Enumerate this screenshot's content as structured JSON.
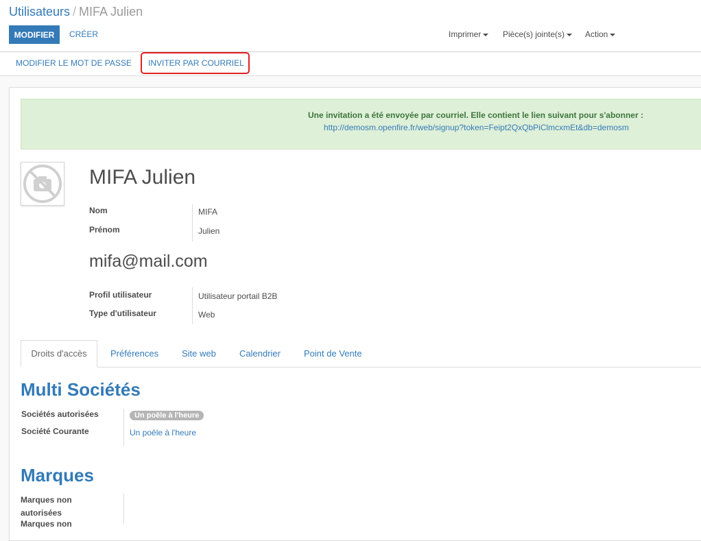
{
  "breadcrumb": {
    "parent": "Utilisateurs",
    "separator": "/",
    "current": "MIFA Julien"
  },
  "toolbar": {
    "edit_label": "MODIFIER",
    "create_label": "CRÉER",
    "print_label": "Imprimer",
    "attachments_label": "Pièce(s) jointe(s)",
    "action_label": "Action"
  },
  "statusbar": {
    "change_password_label": "MODIFIER LE MOT DE PASSE",
    "invite_label": "INVITER PAR COURRIEL"
  },
  "alert": {
    "message": "Une invitation a été envoyée par courriel. Elle contient le lien suivant pour s'abonner :",
    "link": "http://demosm.openfire.fr/web/signup?token=Feipt2QxQbPiClmcxmEt&db=demosm"
  },
  "user": {
    "full_name": "MIFA Julien",
    "email": "mifa@mail.com"
  },
  "fields": {
    "nom_label": "Nom",
    "nom_value": "MIFA",
    "prenom_label": "Prénom",
    "prenom_value": "Julien",
    "profil_label": "Profil utilisateur",
    "profil_value": "Utilisateur portail B2B",
    "type_label": "Type d'utilisateur",
    "type_value": "Web"
  },
  "tabs": [
    {
      "label": "Droits d'accès"
    },
    {
      "label": "Préférences"
    },
    {
      "label": "Site web"
    },
    {
      "label": "Calendrier"
    },
    {
      "label": "Point de Vente"
    }
  ],
  "multi_societes": {
    "title": "Multi Sociétés",
    "allowed_label": "Sociétés autorisées",
    "allowed_badge": "Un poêle à l'heure",
    "current_label": "Société Courante",
    "current_value": "Un poêle à l'heure"
  },
  "marques": {
    "title": "Marques",
    "unauthorized_label_line1": "Marques non",
    "unauthorized_label_line2": "autorisées",
    "next_label_line1": "Marques non"
  },
  "colors": {
    "primary": "#337ab7",
    "alert_bg": "#dff0d8",
    "alert_text": "#3c763d",
    "highlight": "#e02020"
  }
}
